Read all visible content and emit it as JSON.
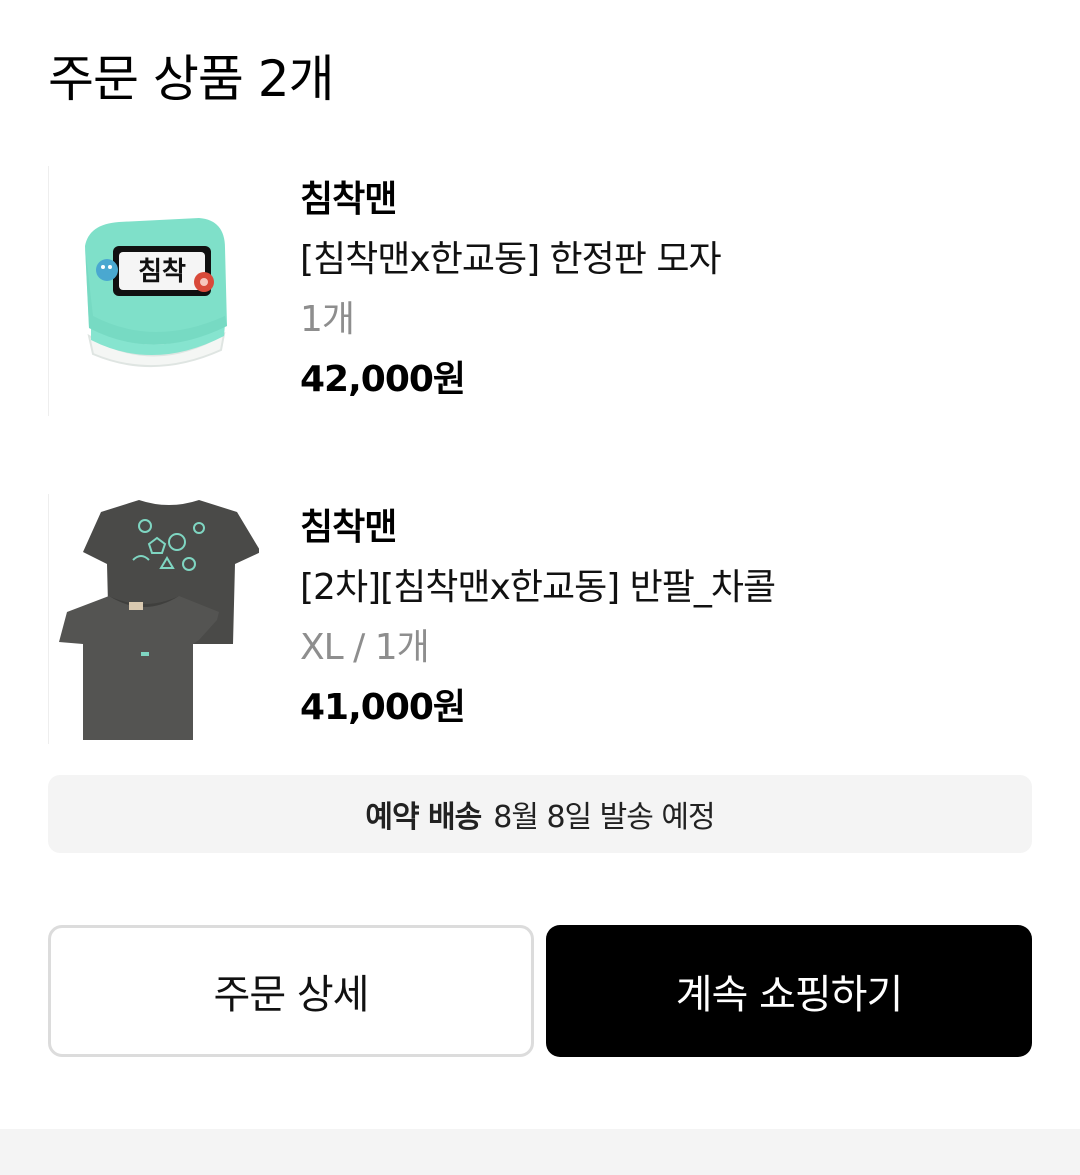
{
  "header": {
    "title": "주문 상품 2개"
  },
  "items": [
    {
      "brand": "침착맨",
      "name": "[침착맨x한교동] 한정판 모자",
      "option": "1개",
      "price": "42,000원",
      "image": "mint-cap-image",
      "image_text": "침착"
    },
    {
      "brand": "침착맨",
      "name": "[2차][침착맨x한교동] 반팔_차콜",
      "option": "XL / 1개",
      "price": "41,000원",
      "image": "charcoal-tshirt-image"
    }
  ],
  "notice": {
    "label": "예약 배송",
    "text": "8월 8일 발송 예정"
  },
  "buttons": {
    "detail": "주문 상세",
    "continue": "계속 쇼핑하기"
  },
  "colors": {
    "primary_button": "#000000",
    "notice_bg": "#f4f4f4",
    "option_text": "#8e8e8e",
    "cap_mint": "#7fe0c9"
  }
}
